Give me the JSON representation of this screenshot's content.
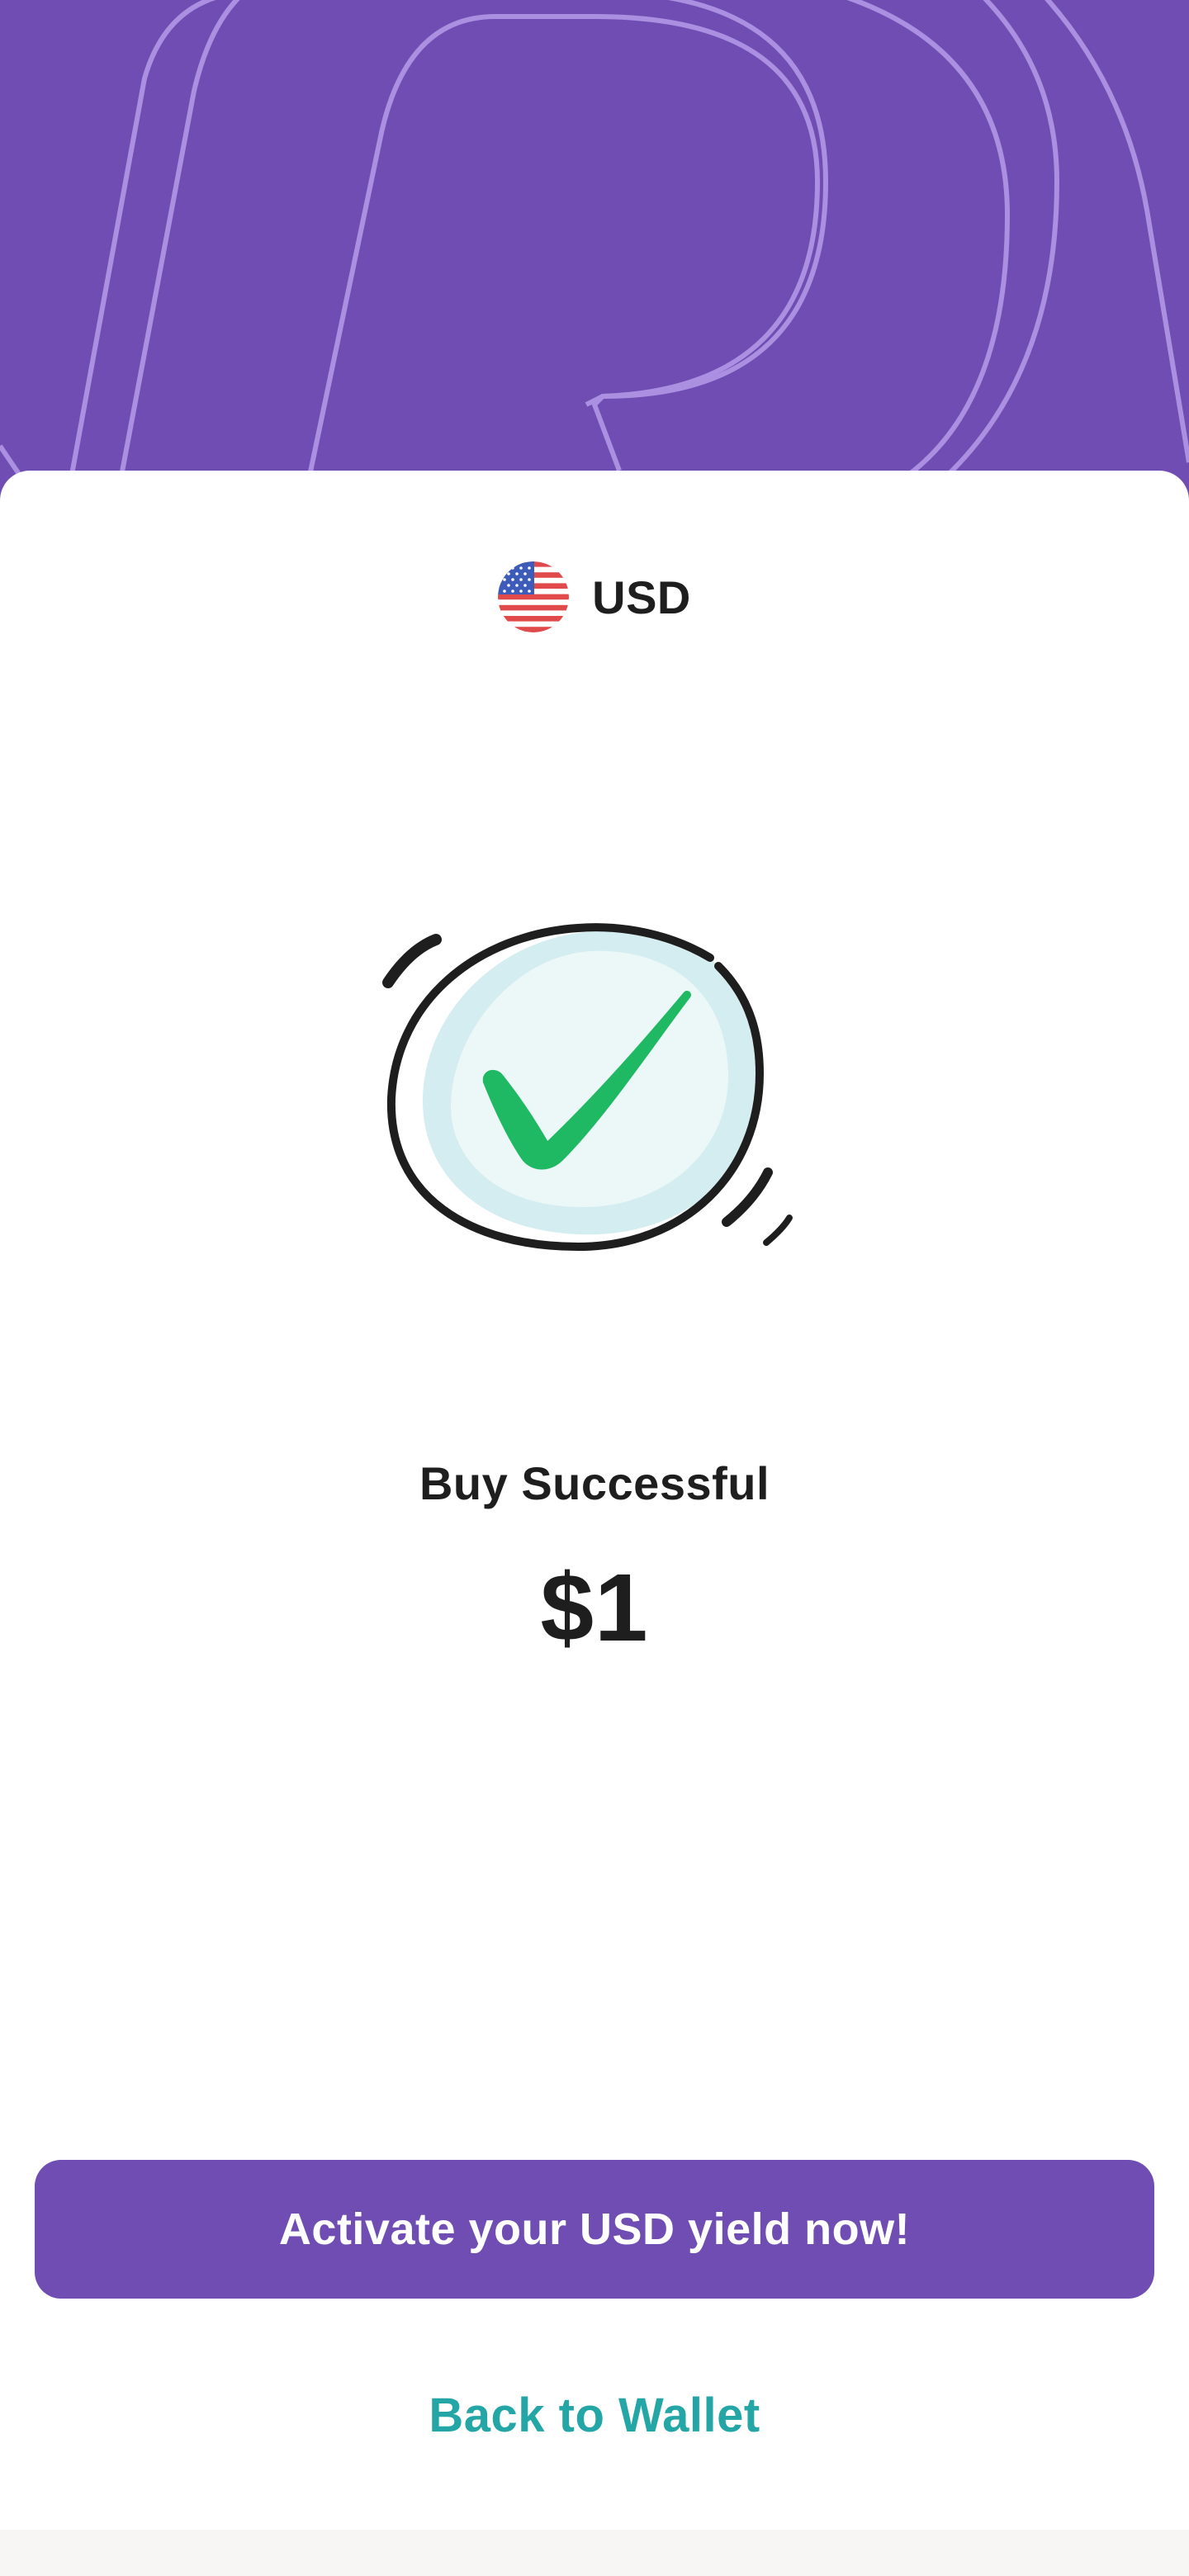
{
  "currency": {
    "code": "USD",
    "flag_icon": "us-flag-icon"
  },
  "status": {
    "title": "Buy Successful",
    "amount": "$1",
    "icon": "success-checkmark-icon"
  },
  "actions": {
    "primary_label": "Activate your USD yield now!",
    "secondary_label": "Back to Wallet"
  },
  "colors": {
    "brand_purple": "#6f4db3",
    "link_teal": "#24a6a6",
    "success_green": "#1fb863",
    "text_dark": "#1e1e1e"
  }
}
